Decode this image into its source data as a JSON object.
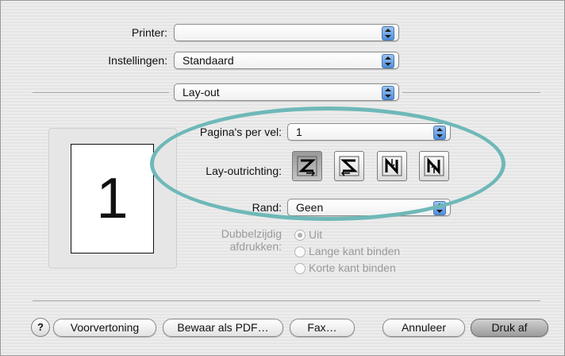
{
  "printer": {
    "label": "Printer:",
    "value": ""
  },
  "settings": {
    "label": "Instellingen:",
    "value": "Standaard"
  },
  "panel": {
    "value": "Lay-out"
  },
  "preview": {
    "page_number": "1"
  },
  "pages_per_sheet": {
    "label": "Pagina's per vel:",
    "value": "1"
  },
  "layout_direction": {
    "label": "Lay-outrichting:",
    "options": [
      "z-left-right-icon",
      "s-right-left-icon",
      "n-top-bottom-icon",
      "n-bottom-top-icon"
    ],
    "selected_index": 0
  },
  "border": {
    "label": "Rand:",
    "value": "Geen"
  },
  "duplex": {
    "label_line1": "Dubbelzijdig",
    "label_line2": "afdrukken:",
    "options": [
      "Uit",
      "Lange kant binden",
      "Korte kant binden"
    ],
    "selected_index": 0
  },
  "buttons": {
    "help": "?",
    "preview": "Voorvertoning",
    "save_pdf": "Bewaar als PDF…",
    "fax": "Fax…",
    "cancel": "Annuleer",
    "print": "Druk af"
  },
  "colors": {
    "highlight_oval": "#6fb8b8",
    "popup_arrow": "#4f8fde"
  }
}
